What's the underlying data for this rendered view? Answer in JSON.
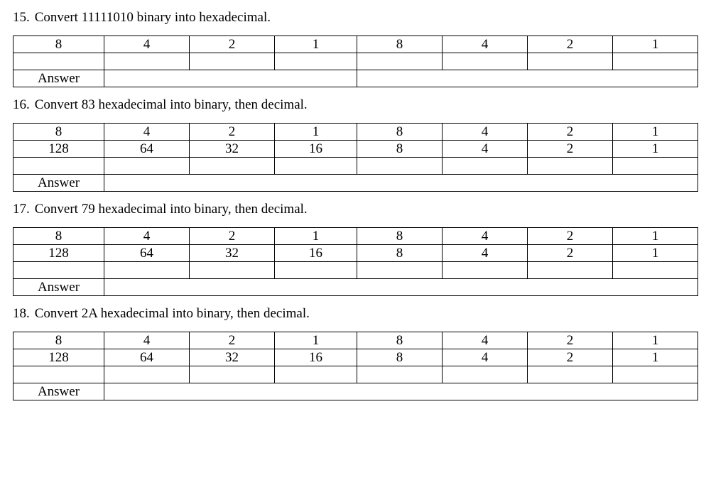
{
  "questions": [
    {
      "num": "15.",
      "prompt": "Convert 11111010 binary into hexadecimal.",
      "rows": [
        [
          "8",
          "4",
          "2",
          "1",
          "8",
          "4",
          "2",
          "1"
        ]
      ],
      "has_blank_row": true,
      "answer_label": "Answer"
    },
    {
      "num": "16.",
      "prompt": "Convert 83 hexadecimal into binary, then decimal.",
      "rows": [
        [
          "8",
          "4",
          "2",
          "1",
          "8",
          "4",
          "2",
          "1"
        ],
        [
          "128",
          "64",
          "32",
          "16",
          "8",
          "4",
          "2",
          "1"
        ]
      ],
      "has_blank_row": true,
      "answer_label": "Answer"
    },
    {
      "num": "17.",
      "prompt": "Convert 79 hexadecimal into binary, then decimal.",
      "rows": [
        [
          "8",
          "4",
          "2",
          "1",
          "8",
          "4",
          "2",
          "1"
        ],
        [
          "128",
          "64",
          "32",
          "16",
          "8",
          "4",
          "2",
          "1"
        ]
      ],
      "has_blank_row": true,
      "answer_label": "Answer"
    },
    {
      "num": "18.",
      "prompt": "Convert 2A hexadecimal into binary, then decimal.",
      "rows": [
        [
          "8",
          "4",
          "2",
          "1",
          "8",
          "4",
          "2",
          "1"
        ],
        [
          "128",
          "64",
          "32",
          "16",
          "8",
          "4",
          "2",
          "1"
        ]
      ],
      "has_blank_row": true,
      "answer_label": "Answer"
    }
  ]
}
